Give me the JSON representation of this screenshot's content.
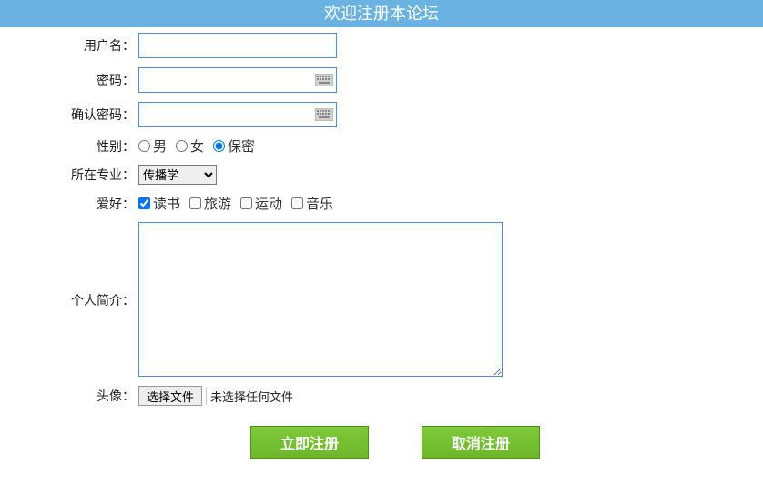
{
  "header": {
    "title": "欢迎注册本论坛"
  },
  "labels": {
    "username": "用户名：",
    "password": "密码：",
    "confirm_password": "确认密码：",
    "gender": "性别：",
    "major": "所在专业：",
    "hobby": "爱好：",
    "bio": "个人简介：",
    "avatar": "头像：",
    "file_button": "选择文件",
    "file_status": "未选择任何文件"
  },
  "fields": {
    "username": {
      "value": ""
    },
    "password": {
      "value": ""
    },
    "confirm_password": {
      "value": ""
    },
    "gender": {
      "options": [
        {
          "label": "男",
          "checked": false
        },
        {
          "label": "女",
          "checked": false
        },
        {
          "label": "保密",
          "checked": true
        }
      ]
    },
    "major": {
      "selected": "传播学"
    },
    "hobby": {
      "options": [
        {
          "label": "读书",
          "checked": true
        },
        {
          "label": "旅游",
          "checked": false
        },
        {
          "label": "运动",
          "checked": false
        },
        {
          "label": "音乐",
          "checked": false
        }
      ]
    },
    "bio": {
      "value": ""
    }
  },
  "buttons": {
    "submit": "立即注册",
    "cancel": "取消注册"
  }
}
